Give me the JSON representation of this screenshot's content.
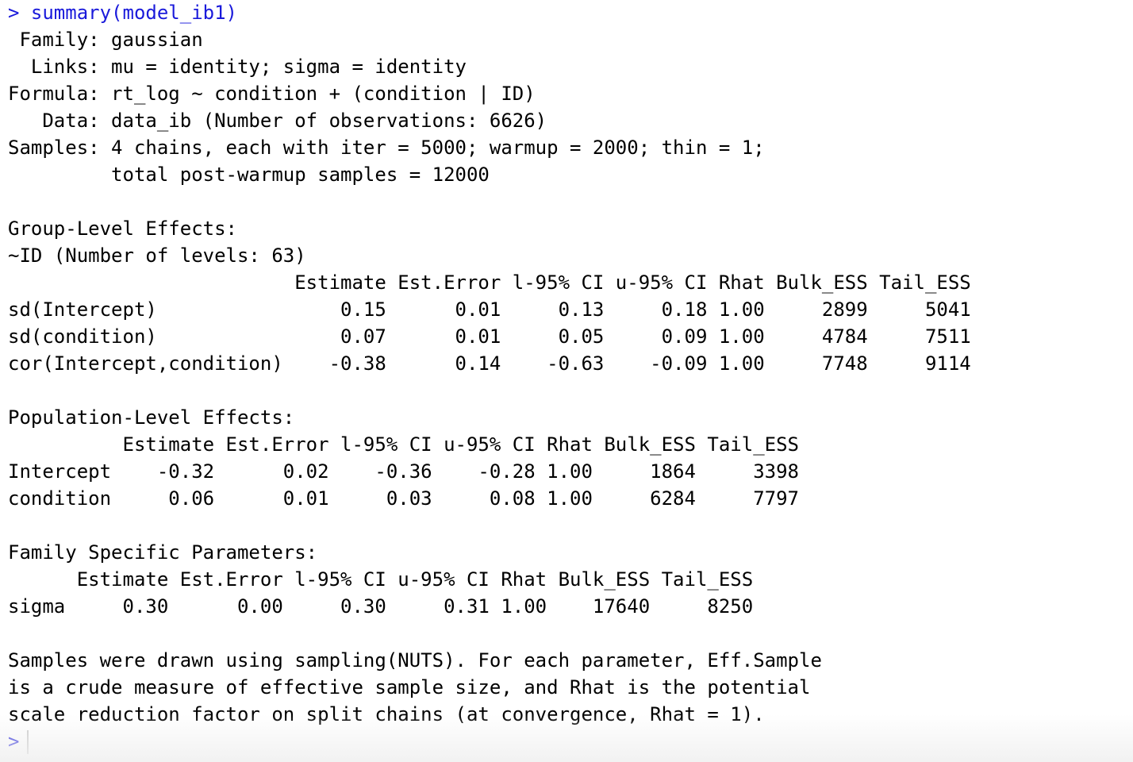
{
  "console": {
    "command_prompt": "> ",
    "command": "summary(model_ib1)",
    "header": [
      " Family: gaussian",
      "  Links: mu = identity; sigma = identity",
      "Formula: rt_log ~ condition + (condition | ID)",
      "   Data: data_ib (Number of observations: 6626)",
      "Samples: 4 chains, each with iter = 5000; warmup = 2000; thin = 1;",
      "         total post-warmup samples = 12000"
    ],
    "group_level": {
      "title": "Group-Level Effects:",
      "subtitle": "~ID (Number of levels: 63)",
      "header": "                         Estimate Est.Error l-95% CI u-95% CI Rhat Bulk_ESS Tail_ESS",
      "rows": [
        "sd(Intercept)                0.15      0.01     0.13     0.18 1.00     2899     5041",
        "sd(condition)                0.07      0.01     0.05     0.09 1.00     4784     7511",
        "cor(Intercept,condition)    -0.38      0.14    -0.63    -0.09 1.00     7748     9114"
      ]
    },
    "population_level": {
      "title": "Population-Level Effects:",
      "header": "          Estimate Est.Error l-95% CI u-95% CI Rhat Bulk_ESS Tail_ESS",
      "rows": [
        "Intercept    -0.32      0.02    -0.36    -0.28 1.00     1864     3398",
        "condition     0.06      0.01     0.03     0.08 1.00     6284     7797"
      ]
    },
    "family_specific": {
      "title": "Family Specific Parameters:",
      "header": "      Estimate Est.Error l-95% CI u-95% CI Rhat Bulk_ESS Tail_ESS",
      "rows": [
        "sigma     0.30      0.00     0.30     0.31 1.00    17640     8250"
      ]
    },
    "footer": [
      "Samples were drawn using sampling(NUTS). For each parameter, Eff.Sample",
      "is a crude measure of effective sample size, and Rhat is the potential",
      "scale reduction factor on split chains (at convergence, Rhat = 1)."
    ],
    "final_prompt": ">"
  },
  "colors": {
    "prompt": "#1a1adb",
    "text": "#000000",
    "background": "#ffffff"
  }
}
